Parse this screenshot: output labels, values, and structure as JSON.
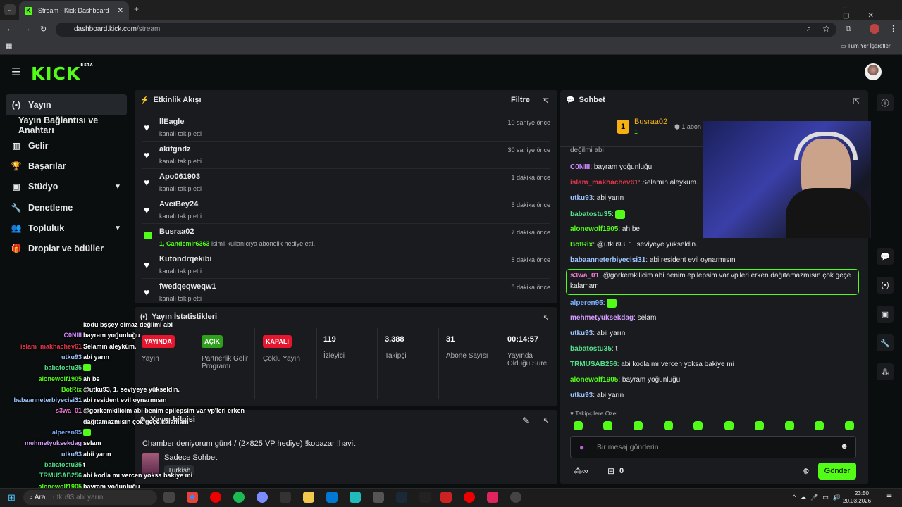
{
  "browser": {
    "tab_title": "Stream - Kick Dashboard",
    "url_domain": "dashboard.kick.com",
    "url_path": "/stream",
    "bookmarks_label": "Tüm Yer İşaretleri"
  },
  "header": {
    "logo": "KICK",
    "logo_tag": "BETA"
  },
  "sidebar": {
    "items": [
      {
        "label": "Yayın",
        "icon": "broadcast-icon"
      },
      {
        "label": "Yayın Bağlantısı ve Anahtarı"
      },
      {
        "label": "Gelir",
        "icon": "chart-icon"
      },
      {
        "label": "Başarılar",
        "icon": "trophy-icon"
      },
      {
        "label": "Stüdyo",
        "icon": "studio-icon"
      },
      {
        "label": "Denetleme",
        "icon": "wrench-icon"
      },
      {
        "label": "Topluluk",
        "icon": "users-icon"
      },
      {
        "label": "Droplar ve ödüller",
        "icon": "gift-icon"
      }
    ]
  },
  "activity": {
    "title": "Etkinlik Akışı",
    "filter": "Filtre",
    "events": [
      {
        "name": "llEagle",
        "sub": "kanalı takip etti",
        "time": "10 saniye önce"
      },
      {
        "name": "akifgndz",
        "sub": "kanalı takip etti",
        "time": "30 saniye önce"
      },
      {
        "name": "Apo061903",
        "sub": "kanalı takip etti",
        "time": "1 dakika önce"
      },
      {
        "name": "AvciBey24",
        "sub": "kanalı takip etti",
        "time": "5 dakika önce"
      },
      {
        "name": "Busraa02",
        "sub_highlight": "1, Candemir6363",
        "sub": " isimli kullanıcıya abonelik hediye etti.",
        "time": "7 dakika önce"
      },
      {
        "name": "Kutondrqekibi",
        "sub": "kanalı takip etti",
        "time": "8 dakika önce"
      },
      {
        "name": "fwedqeqweqw1",
        "sub": "kanalı takip etti",
        "time": "8 dakika önce"
      }
    ]
  },
  "stats": {
    "title": "Yayın İstatistikleri",
    "items": [
      {
        "badge": "YAYINDA",
        "label": "Yayın",
        "color": "#e5162e"
      },
      {
        "badge": "AÇIK",
        "label": "Partnerlik Gelir Programı",
        "color": "#2fa01c"
      },
      {
        "badge": "KAPALI",
        "label": "Çoklu Yayın",
        "color": "#e5162e"
      },
      {
        "num": "119",
        "label": "İzleyici"
      },
      {
        "num": "3.388",
        "label": "Takipçi"
      },
      {
        "num": "31",
        "label": "Abone Sayısı"
      },
      {
        "num": "00:14:57",
        "label": "Yayında Olduğu Süre"
      }
    ]
  },
  "streaminfo": {
    "title": "Yayın bilgisi",
    "stream_title": "Chamber deniyorum gün4 / (2×825 VP hediye) !kopazar !havit",
    "category": "Sadece Sohbet",
    "language": "Turkish"
  },
  "chat": {
    "title": "Sohbet",
    "pinned_user": "Busraa02",
    "pinned_count": "1",
    "pinned_extra": "1 abon",
    "messages": [
      {
        "user": "",
        "text": "değilmi abi",
        "color": "#e8e8e8"
      },
      {
        "user": "C0NIII",
        "text": "bayram yoğunluğu",
        "color": "#d08bff"
      },
      {
        "user": "islam_makhachev61",
        "text": "Selamın aleyküm.",
        "color": "#e4364a"
      },
      {
        "user": "utku93",
        "text": "abi yarın",
        "color": "#9fc5ff"
      },
      {
        "user": "babatostu35",
        "text": "",
        "color": "#53e08a"
      },
      {
        "user": "alonewolf1905",
        "text": "ah be",
        "color": "#53fc18"
      },
      {
        "user": "BotRix",
        "text": "@utku93, 1. seviyeye yükseldin.",
        "color": "#53fc18"
      },
      {
        "user": "babaanneterbiyecisi31",
        "text": "abi resident evil oynarmısın",
        "color": "#9fc5ff"
      },
      {
        "user": "s3wa_01",
        "text": "@gorkemkilicim abi benim epilepsim var vp'leri erken dağıtamazmısın çok geçe",
        "text2": "kalamam",
        "color": "#f07bd0"
      },
      {
        "user": "alperen95",
        "text": "",
        "color": "#7ab0ff"
      },
      {
        "user": "mehmetyuksekdag",
        "text": "selam",
        "color": "#d59cff"
      },
      {
        "user": "utku93",
        "text": "abii yarın",
        "color": "#9fc5ff"
      },
      {
        "user": "babatostu35",
        "text": "t",
        "color": "#53e08a"
      },
      {
        "user": "TRMUSAB256",
        "text": "abi kodla mı vercen yoksa bakiye mi",
        "color": "#53e08a"
      },
      {
        "user": "alonewolf1905",
        "text": "bayram yoğunluğu",
        "color": "#53fc18"
      },
      {
        "user": "utku93",
        "text": "abi yarın",
        "color": "#9fc5ff"
      }
    ],
    "followers_only": "Takipçilere Özel",
    "input_placeholder": "Bir mesaj gönderin",
    "points": "0",
    "send": "Gönder"
  },
  "overlay": {
    "lines": [
      {
        "user": "",
        "text": "kodu bşşey olmaz değilmi abi",
        "color": "#ffffff"
      },
      {
        "user": "C0NIII",
        "text": "bayram yoğunluğu",
        "color": "#d08bff"
      },
      {
        "user": "islam_makhachev61",
        "text": "Selamın aleyküm.",
        "color": "#e4364a"
      },
      {
        "user": "utku93",
        "text": "abi yarın",
        "color": "#9fc5ff"
      },
      {
        "user": "babatostu35",
        "text": "",
        "color": "#53e08a"
      },
      {
        "user": "alonewolf1905",
        "text": "ah be",
        "color": "#53fc18"
      },
      {
        "user": "BotRix",
        "text": "@utku93, 1. seviyeye yükseldin.",
        "color": "#53fc18"
      },
      {
        "user": "babaanneterbiyecisi31",
        "text": "abi resident evil oynarmısın",
        "color": "#9fc5ff"
      },
      {
        "user": "s3wa_01",
        "text": "@gorkemkilicim abi benim epilepsim var vp'leri erken",
        "color": "#f07bd0"
      },
      {
        "user": "",
        "text": "dağıtamazmısın çok geçe kalamam",
        "color": "#ffffff"
      },
      {
        "user": "alperen95",
        "text": "",
        "color": "#7ab0ff"
      },
      {
        "user": "mehmetyuksekdag",
        "text": "selam",
        "color": "#d59cff"
      },
      {
        "user": "utku93",
        "text": "abii yarın",
        "color": "#9fc5ff"
      },
      {
        "user": "babatostu35",
        "text": "t",
        "color": "#53e08a"
      },
      {
        "user": "TRMUSAB256",
        "text": "abi kodla mı vercen yoksa bakiye mi",
        "color": "#53e08a"
      },
      {
        "user": "alonewolf1905",
        "text": "bayram yoğunluğu",
        "color": "#53fc18"
      }
    ]
  },
  "taskbar": {
    "search": "Ara",
    "search_hint": "utku93 abi yarın",
    "time": "23:50",
    "date": "20.03.2026"
  },
  "colors": {
    "accent": "#53fc18",
    "panel": "#191b1f",
    "bg": "#0b0e0f"
  }
}
